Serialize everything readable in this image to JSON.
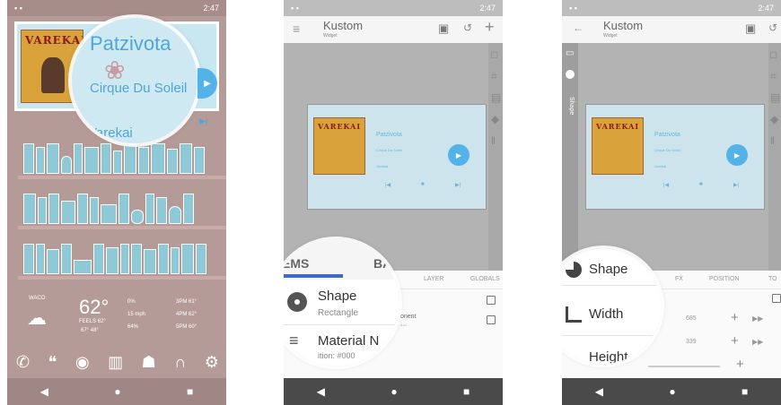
{
  "status": {
    "time": "2:47"
  },
  "panel1": {
    "song": "Patzivota",
    "artist": "Cirque Du Soleil",
    "album": "Varekai",
    "album_art_text": "VAREKAI",
    "weather": {
      "city": "WACO",
      "temperature": "62°",
      "feels_like": "FEELS 62°",
      "hi_lo": "67° 48°",
      "precip": "0%",
      "wind": "15 mph",
      "humidity": "64%",
      "forecast": [
        "3PM 61°",
        "4PM 62°",
        "5PM 60°"
      ]
    },
    "dock_icons": [
      "phone-icon",
      "message-icon",
      "chrome-icon",
      "books-icon",
      "android-icon",
      "headphones-icon",
      "settings-icon"
    ]
  },
  "panel2": {
    "app_title": "Kustom",
    "app_subtitle": "Widget",
    "preview": {
      "song": "Patzivota",
      "artist": "Cirque Du Soleil",
      "album": "Varekai"
    },
    "tabs": [
      "LAYER",
      "GLOBALS"
    ],
    "magnifier": {
      "tab_left": "EMS",
      "tab_right": "BA",
      "item1_title": "Shape",
      "item1_sub": "Rectangle",
      "item2_title": "Material N",
      "item2_sub": "ition: #000"
    },
    "list_row2_text": "onent",
    "list_row2_sub": "d.ic/..."
  },
  "panel3": {
    "app_title": "Kustom",
    "app_subtitle": "Widget",
    "side_tab_label": "Shape",
    "preview": {
      "song": "Patzivota",
      "artist": "Cirque Du Soleil",
      "album": "Varekai"
    },
    "tabs": [
      "FX",
      "POSITION",
      "TO"
    ],
    "width_value": "685",
    "height_value": "339",
    "magnifier": {
      "item1": "Shape",
      "item2": "Width",
      "item3": "Height"
    }
  }
}
